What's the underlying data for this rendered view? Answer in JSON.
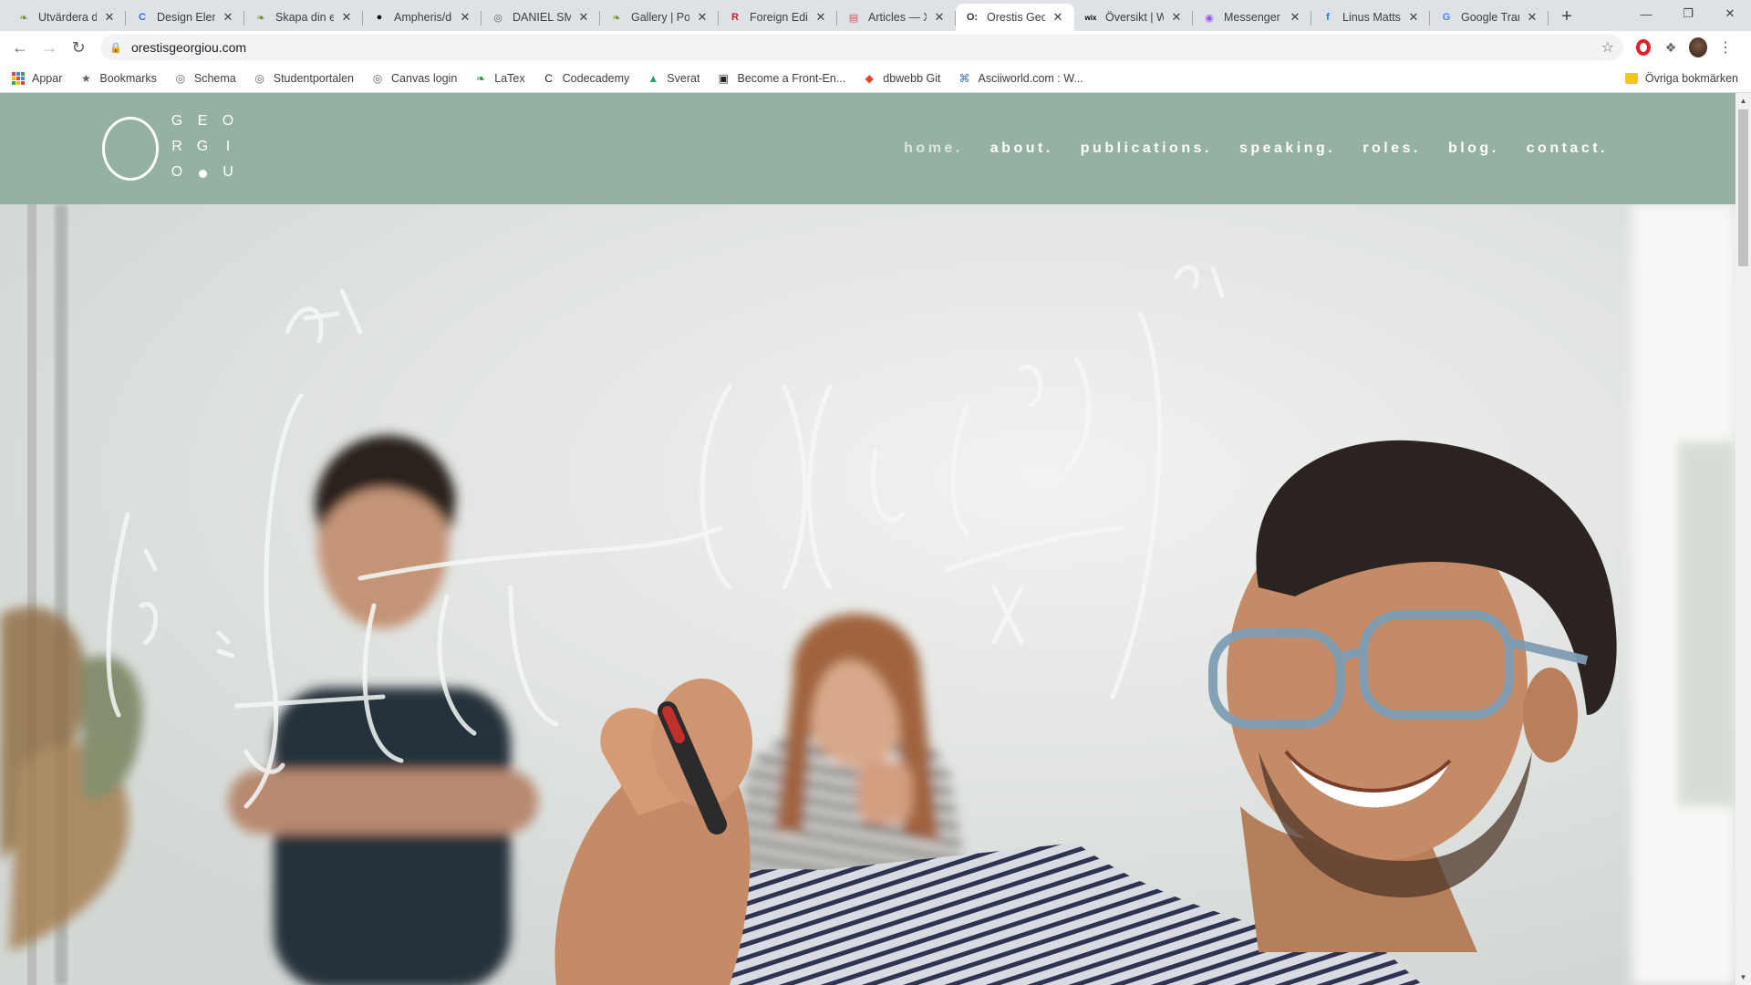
{
  "browser": {
    "tabs": [
      {
        "title": "Utvärdera din",
        "fav": "bird"
      },
      {
        "title": "Design Elem",
        "fav": "c-circle"
      },
      {
        "title": "Skapa din e",
        "fav": "bird"
      },
      {
        "title": "Ampheris/d",
        "fav": "github"
      },
      {
        "title": "DANIEL SMI",
        "fav": "globe"
      },
      {
        "title": "Gallery | Por",
        "fav": "bird"
      },
      {
        "title": "Foreign Edit",
        "fav": "R"
      },
      {
        "title": "Articles — X",
        "fav": "news"
      },
      {
        "title": "Orestis Geo",
        "fav": "og",
        "active": true
      },
      {
        "title": "Översikt | W",
        "fav": "wix"
      },
      {
        "title": "Messenger",
        "fav": "messenger"
      },
      {
        "title": "Linus Matts",
        "fav": "facebook"
      },
      {
        "title": "Google Tran",
        "fav": "translate"
      }
    ],
    "new_tab_glyph": "+",
    "url": "orestisgeorgiou.com",
    "bookmarks": [
      {
        "label": "Appar",
        "icon": "apps-grid-icon"
      },
      {
        "label": "Bookmarks",
        "icon": "star-icon"
      },
      {
        "label": "Schema",
        "icon": "globe-icon"
      },
      {
        "label": "Studentportalen",
        "icon": "globe-icon"
      },
      {
        "label": "Canvas login",
        "icon": "globe-icon"
      },
      {
        "label": "LaTex",
        "icon": "leaf-icon"
      },
      {
        "label": "Codecademy",
        "icon": "codecademy-icon"
      },
      {
        "label": "Sverat",
        "icon": "drive-icon"
      },
      {
        "label": "Become a Front-En...",
        "icon": "terminal-icon"
      },
      {
        "label": "dbwebb Git",
        "icon": "gitlab-icon"
      },
      {
        "label": "Asciiworld.com : W...",
        "icon": "ascii-icon"
      }
    ],
    "other_bookmarks": "Övriga bokmärken"
  },
  "site": {
    "logo": {
      "big_letter": "O",
      "letters": [
        "G",
        "E",
        "O",
        "R",
        "G",
        "I",
        "O",
        "U"
      ]
    },
    "nav": [
      {
        "label": "home.",
        "active": true
      },
      {
        "label": "about."
      },
      {
        "label": "publications."
      },
      {
        "label": "speaking."
      },
      {
        "label": "roles."
      },
      {
        "label": "blog."
      },
      {
        "label": "contact."
      }
    ],
    "colors": {
      "header": "#95b1a3",
      "nav_text": "#ffffff"
    }
  }
}
